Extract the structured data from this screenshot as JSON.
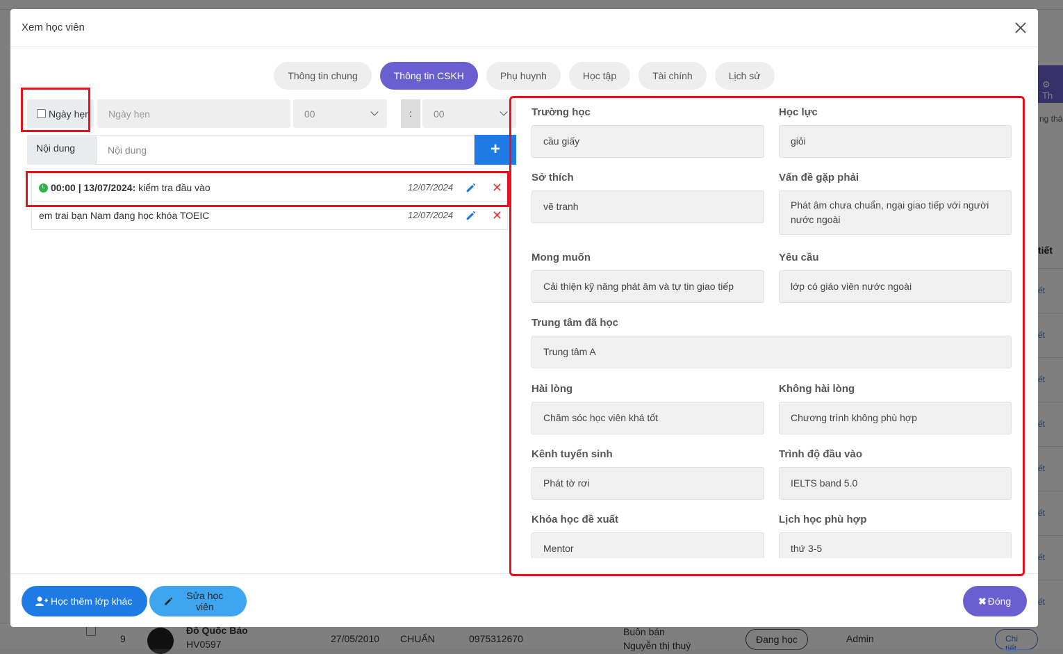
{
  "background": {
    "side_tab": "Th",
    "side_label": "ng thá",
    "side_header": "tiết",
    "side_link": "ết",
    "bottom_row": {
      "index": "9",
      "name": "Đỗ Quốc Bảo",
      "code": "HV0597",
      "dob": "27/05/2010",
      "level": "CHUẨN",
      "phone": "0975312670",
      "job": "Buôn bán",
      "parent": "Nguyễn thị thuý",
      "status": "Đang học",
      "owner": "Admin",
      "detail": "Chi tiết"
    }
  },
  "modal": {
    "title": "Xem học viên",
    "tabs": [
      "Thông tin chung",
      "Thông tin CSKH",
      "Phụ huynh",
      "Học tập",
      "Tài chính",
      "Lịch sử"
    ],
    "active_tab": "Thông tin CSKH"
  },
  "appointment": {
    "checkbox_label": "Ngày hẹn",
    "date_placeholder": "Ngày hẹn",
    "hour": "00",
    "colon": ":",
    "minute": "00",
    "content_label": "Nội dung",
    "content_placeholder": "Nội dung",
    "add_label": "+"
  },
  "notes": [
    {
      "time": "00:00 | 13/07/2024:",
      "text": "kiểm tra đầu vào",
      "date": "12/07/2024"
    },
    {
      "time": "",
      "text": "em trai bạn Nam đang học khóa TOEIC",
      "date": "12/07/2024"
    }
  ],
  "cskh": {
    "school_label": "Trường học",
    "school": "cầu giấy",
    "academic_label": "Học lực",
    "academic": "giỏi",
    "hobby_label": "Sở thích",
    "hobby": "vẽ tranh",
    "problem_label": "Vấn đề gặp phải",
    "problem": "Phát âm chưa chuẩn, ngại giao tiếp với người nước ngoài",
    "wish_label": "Mong muốn",
    "wish": "Cải thiện kỹ năng phát âm và tự tin giao tiếp",
    "request_label": "Yêu cầu",
    "request": "lớp có giáo viên nước ngoài",
    "center_label": "Trung tâm đã học",
    "center": "Trung tâm A",
    "satisfied_label": "Hài lòng",
    "satisfied": "Chăm sóc học viên khá tốt",
    "unsatisfied_label": "Không hài lòng",
    "unsatisfied": "Chương trình không phù hợp",
    "channel_label": "Kênh tuyển sinh",
    "channel": "Phát tờ rơi",
    "entry_label": "Trình độ đầu vào",
    "entry": "IELTS band 5.0",
    "course_label": "Khóa học đề xuất",
    "course": "Mentor",
    "schedule_label": "Lịch học phù hợp",
    "schedule": "thứ 3-5"
  },
  "footer": {
    "add_class": "Học thêm lớp khác",
    "edit_student": "Sửa học viên",
    "close": "Đóng"
  },
  "colors": {
    "accent": "#6a5fd1",
    "primary_blue": "#1e7be6",
    "light_blue": "#3ea6f0",
    "highlight": "#e8101a"
  }
}
